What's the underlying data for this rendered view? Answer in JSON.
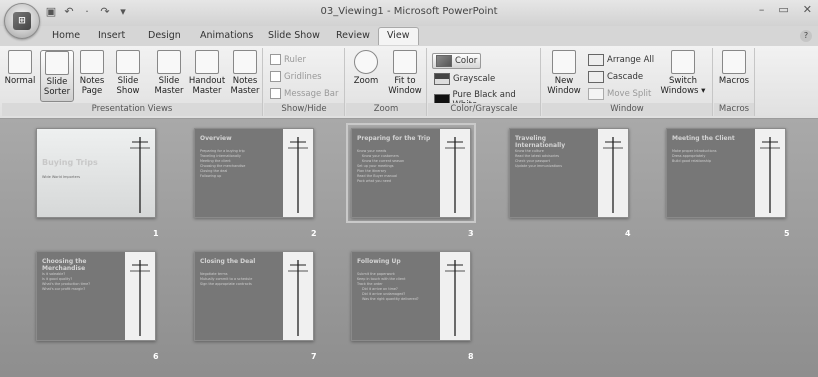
{
  "window": {
    "title": "03_Viewing1 - Microsoft PowerPoint",
    "minimize": "–",
    "restore": "▭",
    "close": "✕",
    "help": "?"
  },
  "office_button": {
    "label": "⊞"
  },
  "qat": {
    "save": "▣",
    "undo": "↶",
    "separator": "·",
    "redo": "↷",
    "customize": "▾"
  },
  "tabs": [
    "Home",
    "Insert",
    "Design",
    "Animations",
    "Slide Show",
    "Review",
    "View"
  ],
  "active_tab": "View",
  "ribbon": {
    "presentation_views": {
      "label": "Presentation Views",
      "normal": "Normal",
      "slide_sorter_1": "Slide",
      "slide_sorter_2": "Sorter",
      "notes_page_1": "Notes",
      "notes_page_2": "Page",
      "slide_show_1": "Slide",
      "slide_show_2": "Show",
      "slide_master_1": "Slide",
      "slide_master_2": "Master",
      "handout_master_1": "Handout",
      "handout_master_2": "Master",
      "notes_master_1": "Notes",
      "notes_master_2": "Master"
    },
    "show_hide": {
      "label": "Show/Hide",
      "ruler": "Ruler",
      "gridlines": "Gridlines",
      "message_bar": "Message Bar"
    },
    "zoom": {
      "label": "Zoom",
      "zoom": "Zoom",
      "fit_1": "Fit to",
      "fit_2": "Window"
    },
    "color_grayscale": {
      "label": "Color/Grayscale",
      "color": "Color",
      "grayscale": "Grayscale",
      "pure_bw": "Pure Black and White"
    },
    "window": {
      "label": "Window",
      "new_1": "New",
      "new_2": "Window",
      "arrange_all": "Arrange All",
      "cascade": "Cascade",
      "move_split": "Move Split",
      "switch_1": "Switch",
      "switch_2": "Windows ▾"
    },
    "macros": {
      "label": "Macros",
      "macros": "Macros"
    }
  },
  "slides": [
    {
      "number": "1",
      "title": "Buying Trips",
      "subtitle": "Wide World Importers",
      "bullets": []
    },
    {
      "number": "2",
      "title": "Overview",
      "bullets": [
        "Preparing for a buying trip",
        "Traveling internationally",
        "Meeting the client",
        "Choosing the merchandise",
        "Closing the deal",
        "Following up"
      ]
    },
    {
      "number": "3",
      "title": "Preparing for the Trip",
      "bullets": [
        "Know your needs",
        "Know your customers",
        "Know the current season",
        "Set up your meetings",
        "Plan the itinerary",
        "Read the Buyer manual",
        "Pack what you need"
      ]
    },
    {
      "number": "4",
      "title": "Traveling Internationally",
      "bullets": [
        "Know the culture",
        "Read the latest advisories",
        "Check your passport",
        "Update your immunizations"
      ]
    },
    {
      "number": "5",
      "title": "Meeting the Client",
      "bullets": [
        "Make proper introductions",
        "Dress appropriately",
        "Build good relationship"
      ]
    },
    {
      "number": "6",
      "title": "Choosing the Merchandise",
      "bullets": [
        "Is it saleable?",
        "Is it good quality?",
        "What's the production time?",
        "What's our profit margin?"
      ]
    },
    {
      "number": "7",
      "title": "Closing the Deal",
      "bullets": [
        "Negotiate terms",
        "Mutually commit to a schedule",
        "Sign the appropriate contracts"
      ]
    },
    {
      "number": "8",
      "title": "Following Up",
      "bullets": [
        "Submit the paperwork",
        "Keep in touch with the client",
        "Track the order",
        "Did it arrive on time?",
        "Did it arrive undamaged?",
        "Was the right quantity delivered?"
      ]
    }
  ]
}
